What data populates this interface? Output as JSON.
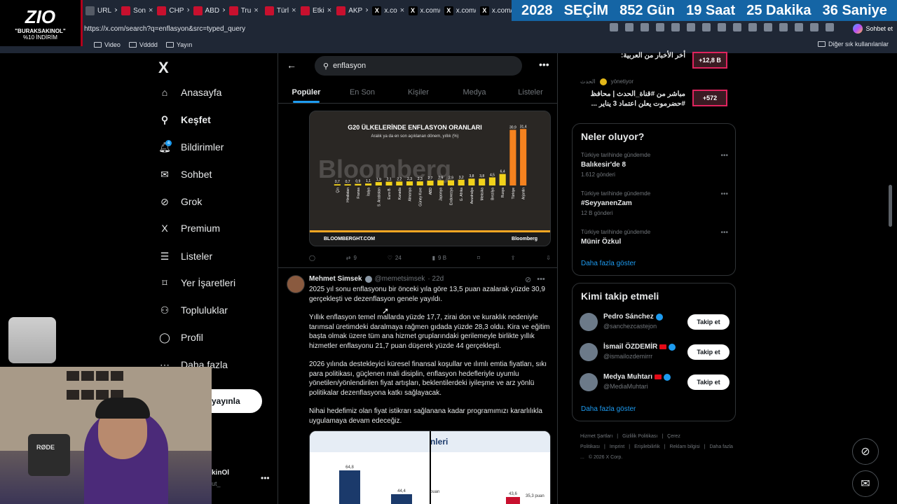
{
  "browser": {
    "tabs": [
      {
        "icon": "link-icon",
        "label": "URL",
        "color": "#555b66"
      },
      {
        "icon": "news-icon",
        "label": "Son",
        "color": "#c8102e"
      },
      {
        "icon": "news-icon",
        "label": "CHP",
        "color": "#c8102e"
      },
      {
        "icon": "news-icon",
        "label": "ABD",
        "color": "#c8102e"
      },
      {
        "icon": "news-icon",
        "label": "Tru",
        "color": "#c8102e"
      },
      {
        "icon": "news-icon",
        "label": "Türl",
        "color": "#c8102e"
      },
      {
        "icon": "news-icon",
        "label": "Etki",
        "color": "#c8102e"
      },
      {
        "icon": "news-icon",
        "label": "AKP",
        "color": "#c8102e"
      },
      {
        "icon": "x-icon",
        "label": "x.co",
        "color": "#000000"
      },
      {
        "icon": "x-icon",
        "label": "x.com/c",
        "color": "#000000"
      },
      {
        "icon": "x-icon",
        "label": "x.com/C",
        "color": "#000000"
      },
      {
        "icon": "x-icon",
        "label": "x.com/v",
        "color": "#000000"
      }
    ],
    "url": "https://x.com/search?q=enflasyon&src=typed_query",
    "chat_label": "Sohbet et",
    "bookmarks": [
      "Video",
      "Vdddd",
      "Yayın"
    ],
    "bookmarks_other": "Diğer sık kullanılanlar"
  },
  "overlay": {
    "logo_mark": "ZIO",
    "logo_line1": "\"BURAKSAKINOL\"",
    "logo_line2": "%10 İNDİRİM",
    "countdown": [
      "2028",
      "SEÇİM",
      "852 Gün",
      "19 Saat",
      "25 Dakika",
      "36 Saniye"
    ],
    "mic_brand": "RØDE"
  },
  "nav": {
    "logo": "X",
    "items": [
      {
        "icon": "home-icon",
        "label": "Anasayfa"
      },
      {
        "icon": "search-icon",
        "label": "Keşfet",
        "active": true
      },
      {
        "icon": "bell-icon",
        "label": "Bildirimler",
        "badge": "4"
      },
      {
        "icon": "mail-icon",
        "label": "Sohbet"
      },
      {
        "icon": "grok-icon",
        "label": "Grok"
      },
      {
        "icon": "x-icon",
        "label": "Premium"
      },
      {
        "icon": "list-icon",
        "label": "Listeler"
      },
      {
        "icon": "bookmark-icon",
        "label": "Yer İşaretleri"
      },
      {
        "icon": "communities-icon",
        "label": "Topluluklar"
      },
      {
        "icon": "profile-icon",
        "label": "Profil"
      },
      {
        "icon": "more-icon",
        "label": "Daha fazla"
      }
    ],
    "post_button": "yayınla",
    "account_name": "kinOl",
    "account_handle": "ut_"
  },
  "main": {
    "search_value": "enflasyon",
    "tabs": [
      {
        "label": "Popüler",
        "active": true
      },
      {
        "label": "En Son"
      },
      {
        "label": "Kişiler"
      },
      {
        "label": "Medya"
      },
      {
        "label": "Listeler"
      }
    ],
    "media1": {
      "title": "G20 ÜLKELERİNDE ENFLASYON ORANLARI",
      "subtitle": "Aralık ya da en son açıklanan dönem, yıllık (%)",
      "watermark": "Bloomberg",
      "footer_left": "BLOOMBERGHT.COM",
      "footer_right": "Bloomberg"
    },
    "actions1": {
      "replies": "",
      "reposts": "9",
      "likes": "24",
      "views": "9 B"
    },
    "tweet": {
      "name": "Mehmet Simsek",
      "handle": "@memetsimsek",
      "time": "· 22d",
      "paragraphs": [
        "2025 yıl sonu enflasyonu bir önceki yıla göre 13,5 puan azalarak yüzde 30,9 gerçekleşti ve dezenflasyon genele yayıldı.",
        "Yıllık enflasyon temel mallarda yüzde 17,7, zirai don ve kuraklık nedeniyle tarımsal üretimdeki daralmaya rağmen gıdada yüzde 28,3 oldu. Kira ve eğitim başta olmak üzere tüm ana hizmet gruplarındaki gerilemeyle birlikte yıllık hizmetler enflasyonu 21,7 puan düşerek yüzde 44 gerçekleşti.",
        "2026 yılında destekleyici küresel finansal koşullar ve ılımlı emtia fiyatları, sıkı para politikası, güçlenen mali disiplin, enflasyon hedefleriyle uyumlu yönetilen/yönlendirilen fiyat artışları, beklentilerdeki iyileşme ve arz yönlü politikalar dezenflasyona katkı sağlayacak.",
        "Nihai hedefimiz olan fiyat istikrarı sağlanana kadar programımızı kararlılıkla uygulamaya devam edeceğiz."
      ],
      "media2_title": "nleri",
      "media2_left_vals": [
        "64,8",
        "44,4"
      ],
      "media2_mid": "puan",
      "media2_right_vals": [
        "43,6",
        "35,3 puan"
      ]
    }
  },
  "right": {
    "news1": {
      "title": "أخر الأخبار من العربية:",
      "count": "+12,8 B"
    },
    "news2": {
      "source": "الحدث",
      "manager": "yönetiyor",
      "title": "مباشر من #قناة_الحدث | محافظ #حضرموت يعلن اعتماد 3 يناير ...",
      "count": "+572"
    },
    "trends_title": "Neler oluyor?",
    "trends": [
      {
        "category": "Türkiye tarihinde gündemde",
        "name": "Balıkesir'de 8",
        "count": "1.612 gönderi"
      },
      {
        "category": "Türkiye tarihinde gündemde",
        "name": "#SeyyanenZam",
        "count": "12 B gönderi"
      },
      {
        "category": "Türkiye tarihinde gündemde",
        "name": "Münir Özkul",
        "count": ""
      }
    ],
    "show_more": "Daha fazla göster",
    "who_title": "Kimi takip etmeli",
    "who": [
      {
        "name": "Pedro Sánchez",
        "handle": "@sanchezcastejon",
        "button": "Takip et"
      },
      {
        "name": "İsmail ÖZDEMİR",
        "handle": "@ismailozdemirrr",
        "button": "Takip et"
      },
      {
        "name": "Medya Muhtarı",
        "handle": "@MediaMuhtari",
        "button": "Takip et"
      }
    ],
    "who_more": "Daha fazla göster",
    "footer": [
      "Hizmet Şartları",
      "|",
      "Gizlilik Politikası",
      "|",
      "Çerez Politikası",
      "|",
      "Imprint",
      "|",
      "Erişilebilirlik",
      "|",
      "Reklam bilgisi",
      "|",
      "Daha fazla ...",
      "© 2026 X Corp."
    ]
  },
  "chart_data": {
    "type": "bar",
    "title": "G20 ÜLKELERİNDE ENFLASYON ORANLARI",
    "subtitle": "Aralık ya da en son açıklanan dönem, yıllık (%)",
    "categories": [
      "Çin",
      "Hindistan",
      "Fransa",
      "İtalya",
      "S. Arabistan",
      "Euro B.",
      "Kanada",
      "Almanya",
      "Güney Kore",
      "ABD",
      "Japonya",
      "Endonezya",
      "G. Afrika",
      "Avustralya",
      "Meksika",
      "Brezilya",
      "Rusya",
      "Türkiye",
      "Arjantin"
    ],
    "values": [
      0.7,
      0.7,
      0.9,
      1.1,
      1.9,
      2.1,
      2.2,
      2.3,
      2.3,
      2.7,
      2.9,
      2.9,
      3.2,
      3.8,
      3.8,
      4.5,
      6.4,
      30.9,
      31.4
    ],
    "highlight": [
      "Türkiye",
      "Arjantin"
    ],
    "colors": {
      "bar": "#f2d21b",
      "highlight": "#f5821f"
    }
  }
}
